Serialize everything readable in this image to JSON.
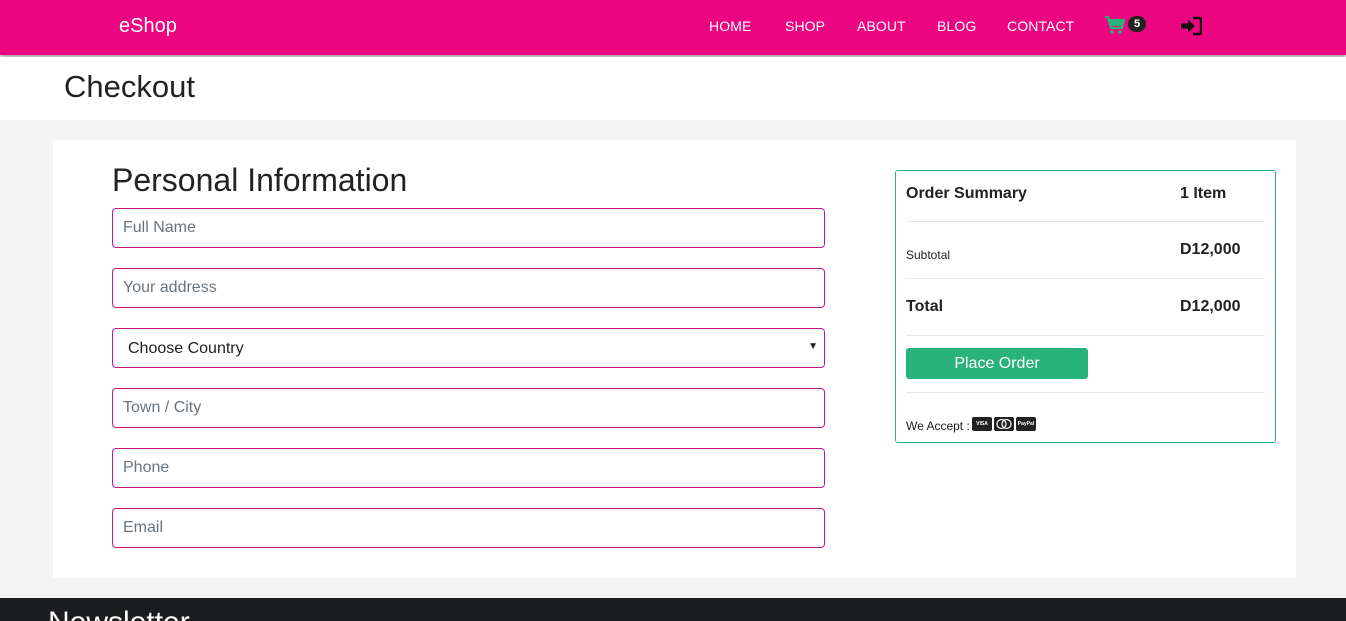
{
  "nav": {
    "brand": "eShop",
    "items": [
      "HOME",
      "SHOP",
      "ABOUT",
      "BLOG",
      "CONTACT"
    ],
    "cart_count": "5",
    "cart_icon": "cart-icon",
    "login_icon": "sign-in-icon",
    "colors": {
      "bar": "#ec0581",
      "cart": "#2ab27b"
    }
  },
  "page": {
    "title": "Checkout"
  },
  "form": {
    "heading": "Personal Information",
    "full_name_placeholder": "Full Name",
    "address_placeholder": "Your address",
    "country_selected": "Choose Country",
    "town_placeholder": "Town / City",
    "phone_placeholder": "Phone",
    "email_placeholder": "Email"
  },
  "summary": {
    "title": "Order Summary",
    "count": "1 Item",
    "subtotal_label": "Subtotal",
    "subtotal_value": "D12,000",
    "total_label": "Total",
    "total_value": "D12,000",
    "button": "Place Order",
    "accept_label": "We Accept :",
    "card_icons": [
      "visa-icon",
      "mastercard-icon",
      "paypal-icon"
    ]
  },
  "footer": {
    "title": "Newsletter"
  }
}
